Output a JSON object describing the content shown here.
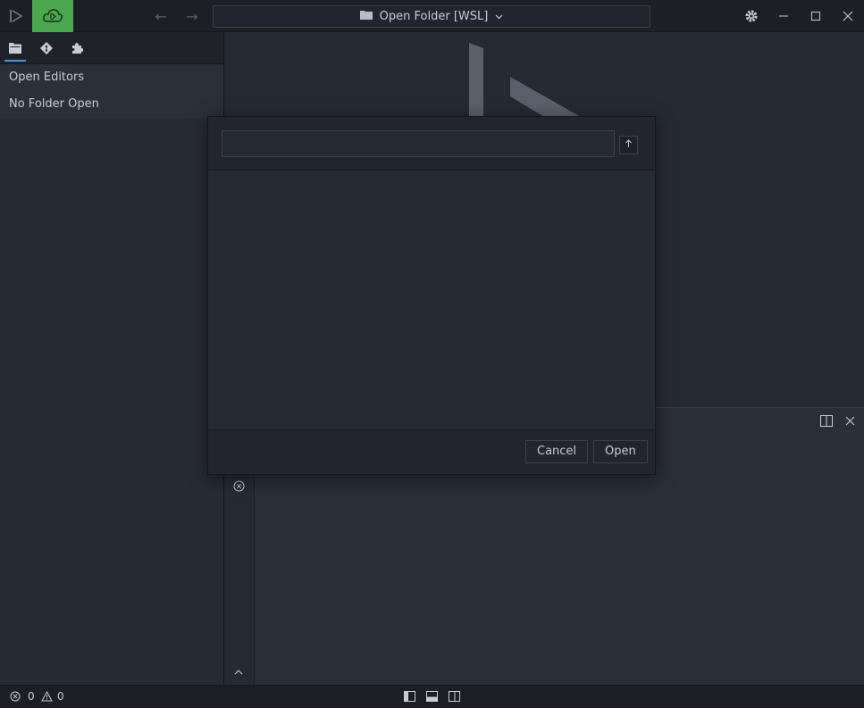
{
  "titlebar": {
    "address_label": "Open Folder [WSL]"
  },
  "sidebar": {
    "items": [
      {
        "label": "Open Editors"
      },
      {
        "label": "No Folder Open"
      }
    ]
  },
  "dialog": {
    "path_value": "",
    "cancel_label": "Cancel",
    "open_label": "Open"
  },
  "statusbar": {
    "errors_count": "0",
    "warnings_count": "0"
  },
  "colors": {
    "accent_green": "#4aa84f",
    "tab_underline": "#4c8fd6",
    "background": "#272b35"
  }
}
